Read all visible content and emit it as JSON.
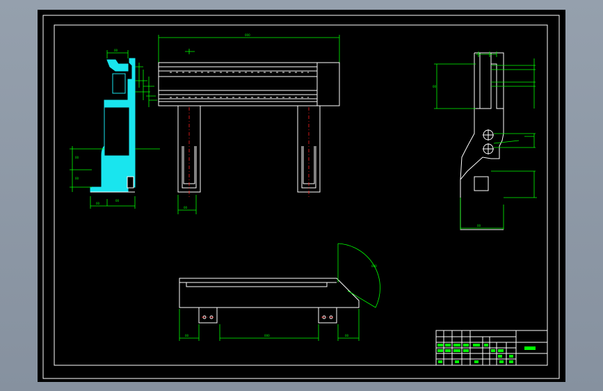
{
  "drawing": {
    "background": "#000000",
    "line_color": "#ffffff",
    "dimension_color": "#00ff00",
    "centerline_color": "#ff2020",
    "hatch_color": "#19e5ee"
  },
  "views": {
    "section_view": "section-view",
    "front_view": "front-view",
    "side_view": "side-view",
    "bottom_view": "bottom-view"
  },
  "title_block": {
    "present": true
  }
}
